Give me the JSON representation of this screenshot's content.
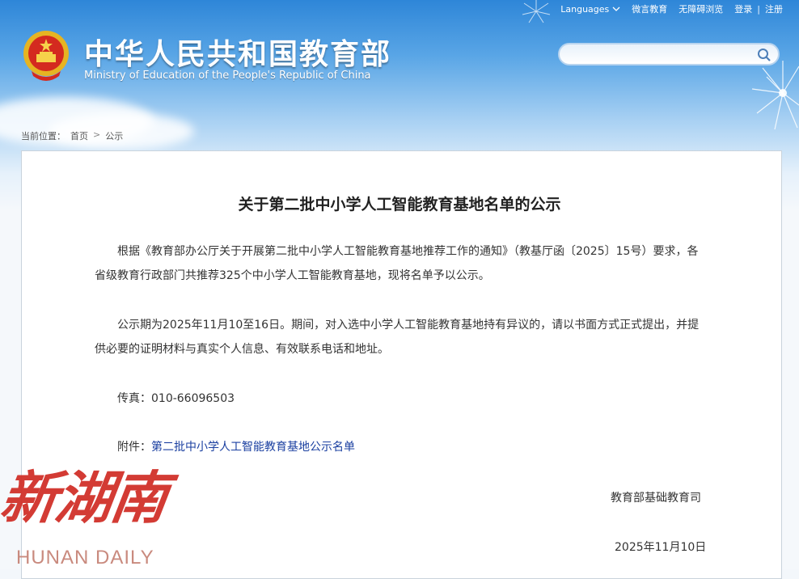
{
  "header": {
    "title_cn": "中华人民共和国教育部",
    "title_en": "Ministry of Education of the People's Republic of China",
    "links": {
      "languages": "Languages",
      "weibo": "微言教育",
      "accessibility": "无障碍浏览",
      "login": "登录",
      "separator": "|",
      "register": "注册"
    },
    "search": {
      "placeholder": ""
    }
  },
  "breadcrumb": {
    "prefix": "当前位置：",
    "home": "首页",
    "arrow": ">",
    "current": "公示"
  },
  "article": {
    "title": "关于第二批中小学人工智能教育基地名单的公示",
    "para1": "根据《教育部办公厅关于开展第二批中小学人工智能教育基地推荐工作的通知》（教基厅函〔2025〕15号）要求，各省级教育行政部门共推荐325个中小学人工智能教育基地，现将名单予以公示。",
    "para2": "公示期为2025年11月10至16日。期间，对入选中小学人工智能教育基地持有异议的，请以书面方式正式提出，并提供必要的证明材料与真实个人信息、有效联系电话和地址。",
    "fax": "传真：010-66096503",
    "attachment_label": "附件：",
    "attachment_link": "第二批中小学人工智能教育基地公示名单",
    "signature": "教育部基础教育司",
    "date": "2025年11月10日"
  },
  "watermark": {
    "cn": "新湖南",
    "en": "HUNAN DAILY"
  },
  "colors": {
    "header_blue": "#2e86d8",
    "link_blue": "#1a3fa0",
    "watermark_red": "#d1312a"
  }
}
